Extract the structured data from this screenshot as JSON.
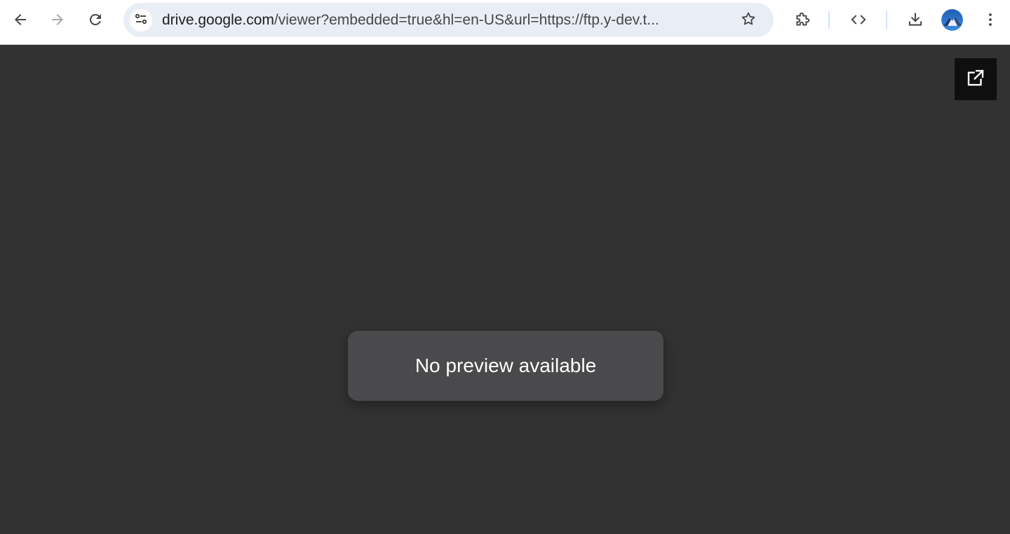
{
  "toolbar": {
    "back_icon": "arrow-left-icon",
    "forward_icon": "arrow-right-icon",
    "reload_icon": "reload-icon",
    "extensions_icon": "puzzle-piece-icon",
    "devtools_icon": "code-brackets-icon",
    "downloads_icon": "download-icon",
    "menu_icon": "kebab-menu-icon"
  },
  "omnibox": {
    "url_host": "drive.google.com",
    "url_rest": "/viewer?embedded=true&hl=en-US&url=https://ftp.y-dev.t...",
    "site_info_icon": "tune-icon",
    "bookmark_icon": "star-outline-icon"
  },
  "viewer": {
    "popout_icon": "open-in-new-icon",
    "message": "No preview available"
  },
  "colors": {
    "viewer_bg": "#323232",
    "omnibox_bg": "#e9eef6",
    "message_bg": "#4a494b",
    "popout_bg": "#0f0f0f"
  }
}
